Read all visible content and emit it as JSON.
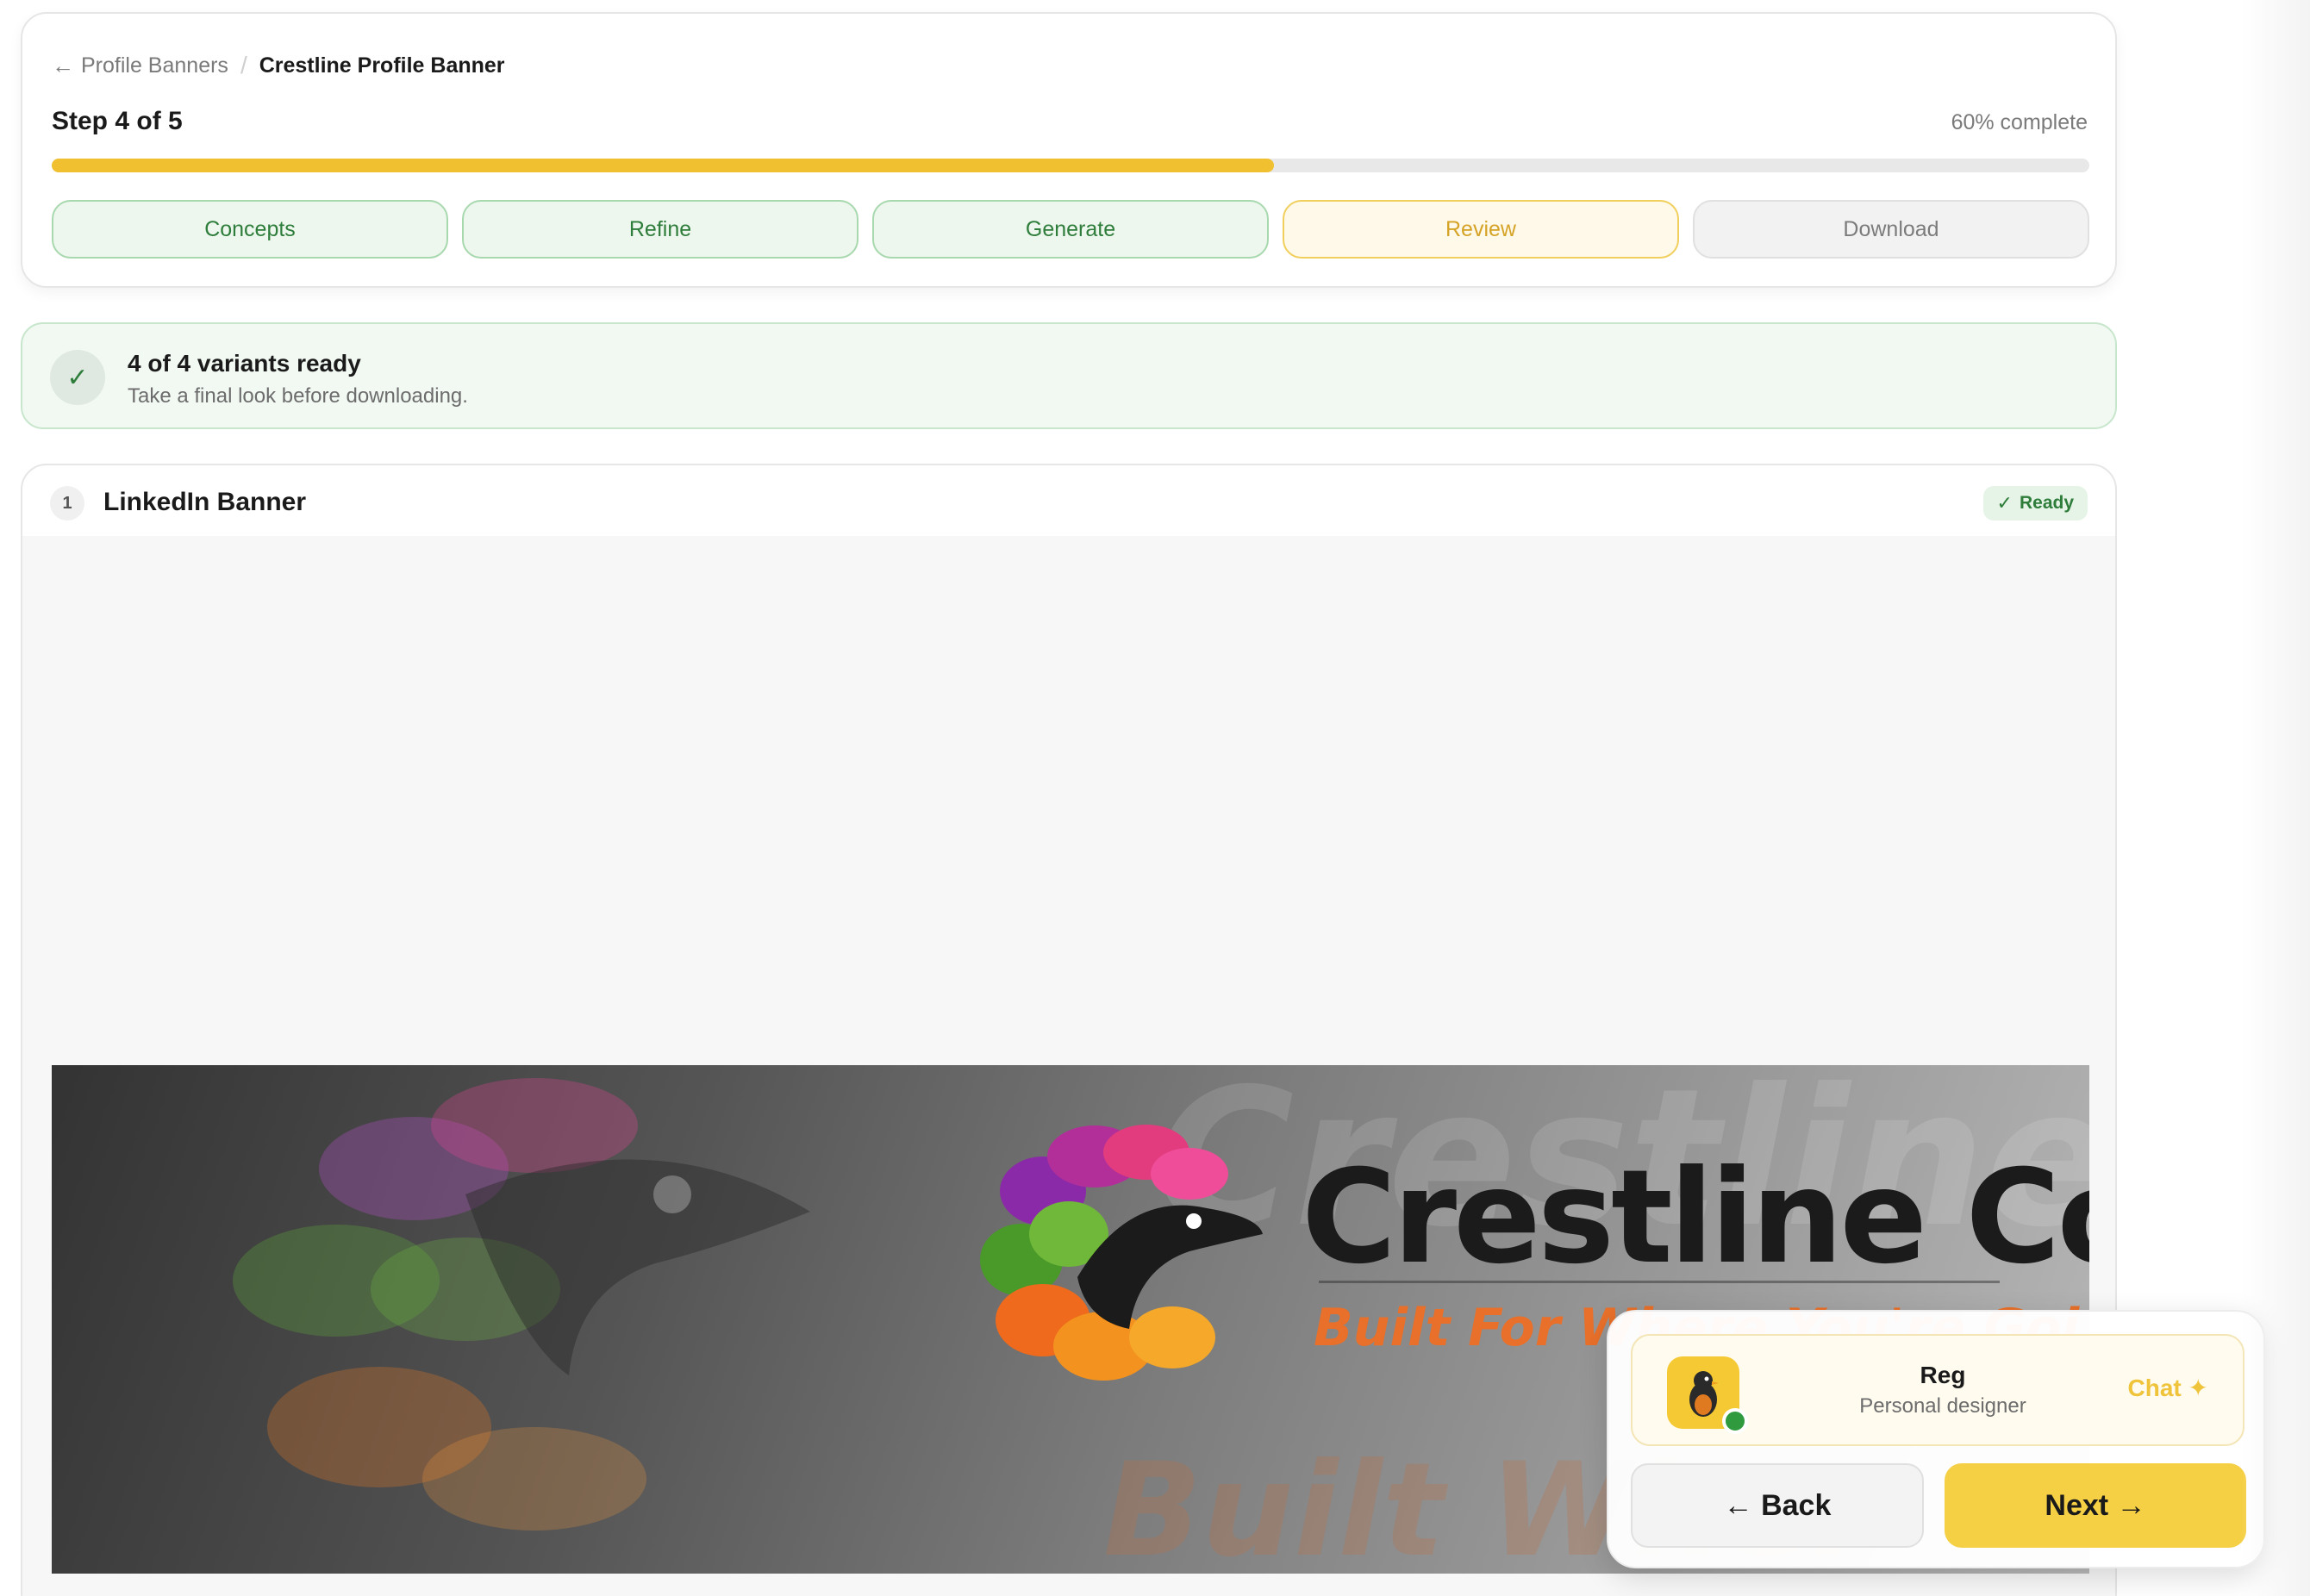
{
  "breadcrumb": {
    "back_label": "Profile Banners",
    "separator": "/",
    "current": "Crestline Profile Banner",
    "back_icon": "arrow-left-icon"
  },
  "progress": {
    "step_label": "Step 4 of 5",
    "percent_label": "60% complete",
    "fill_fraction": 0.6,
    "fill_color": "#f0c030",
    "steps": [
      {
        "label": "Concepts",
        "state": "done"
      },
      {
        "label": "Refine",
        "state": "done"
      },
      {
        "label": "Generate",
        "state": "done"
      },
      {
        "label": "Review",
        "state": "active"
      },
      {
        "label": "Download",
        "state": "todo"
      }
    ]
  },
  "status": {
    "title": "4 of 4 variants ready",
    "subtitle": "Take a final look before downloading.",
    "icon": "check-icon"
  },
  "variant": {
    "number": "1",
    "title": "LinkedIn Banner",
    "badge": "Ready",
    "banner": {
      "brand": "Crestline Co.",
      "tagline": "Built For Where You're Goi",
      "ghost_text_top": "Crestline",
      "ghost_text_bottom": "Built Wher"
    }
  },
  "assistant": {
    "name": "Reg",
    "role": "Personal designer",
    "chat_label": "Chat ✦",
    "avatar_icon": "bird-icon"
  },
  "nav": {
    "back_label": "← Back",
    "next_label": "Next →"
  },
  "colors": {
    "accent": "#f5cf44",
    "success": "#2e7d3a",
    "success_bg": "#edf7ee"
  }
}
